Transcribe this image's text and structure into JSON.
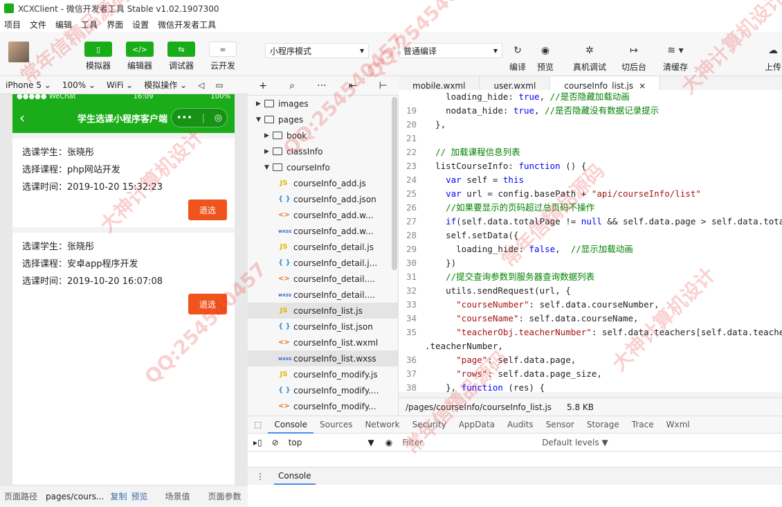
{
  "window": {
    "title": "XCXClient - 微信开发者工具 Stable v1.02.1907300"
  },
  "menu": [
    "项目",
    "文件",
    "编辑",
    "工具",
    "界面",
    "设置",
    "微信开发者工具"
  ],
  "toolbar": {
    "simulator": "模拟器",
    "editor": "编辑器",
    "debugger": "调试器",
    "cloud": "云开发",
    "mode": "小程序模式",
    "compile_mode": "普通编译",
    "compile": "编译",
    "preview": "预览",
    "remote_debug": "真机调试",
    "background": "切后台",
    "clear_cache": "清缓存",
    "upload": "上传"
  },
  "device_bar": {
    "device": "iPhone 5",
    "zoom": "100%",
    "network": "WiFi",
    "ops": "模拟操作"
  },
  "phone": {
    "status_left": "●●●●● WeChat",
    "status_time": "16:09",
    "status_right": "100%",
    "nav_title": "学生选课小程序客户端",
    "records": [
      {
        "student": "选课学生：张晓彤",
        "course": "选择课程：php网站开发",
        "time": "选课时间：2019-10-20 15:32:23",
        "btn": "退选"
      },
      {
        "student": "选课学生：张晓彤",
        "course": "选择课程：安卓app程序开发",
        "time": "选课时间：2019-10-20 16:07:08",
        "btn": "退选"
      }
    ]
  },
  "tree": [
    {
      "name": "images",
      "type": "folder",
      "level": 0,
      "open": false
    },
    {
      "name": "pages",
      "type": "folder",
      "level": 0,
      "open": true
    },
    {
      "name": "book",
      "type": "folder",
      "level": 1,
      "open": false
    },
    {
      "name": "classInfo",
      "type": "folder",
      "level": 1,
      "open": false
    },
    {
      "name": "courseInfo",
      "type": "folder",
      "level": 1,
      "open": true
    },
    {
      "name": "courseInfo_add.js",
      "type": "js",
      "level": 2
    },
    {
      "name": "courseInfo_add.json",
      "type": "json",
      "level": 2
    },
    {
      "name": "courseInfo_add.w...",
      "type": "wxml",
      "level": 2
    },
    {
      "name": "courseInfo_add.w...",
      "type": "wxss",
      "level": 2
    },
    {
      "name": "courseInfo_detail.js",
      "type": "js",
      "level": 2
    },
    {
      "name": "courseInfo_detail.j...",
      "type": "json",
      "level": 2
    },
    {
      "name": "courseInfo_detail....",
      "type": "wxml",
      "level": 2
    },
    {
      "name": "courseInfo_detail....",
      "type": "wxss",
      "level": 2
    },
    {
      "name": "courseInfo_list.js",
      "type": "js",
      "level": 2,
      "selected": true
    },
    {
      "name": "courseInfo_list.json",
      "type": "json",
      "level": 2
    },
    {
      "name": "courseInfo_list.wxml",
      "type": "wxml",
      "level": 2
    },
    {
      "name": "courseInfo_list.wxss",
      "type": "wxss",
      "level": 2,
      "selected": true
    },
    {
      "name": "courseInfo_modify.js",
      "type": "js",
      "level": 2
    },
    {
      "name": "courseInfo_modify....",
      "type": "json",
      "level": 2
    },
    {
      "name": "courseInfo_modify...",
      "type": "wxml",
      "level": 2
    }
  ],
  "tabs": [
    "mobile.wxml",
    "user.wxml",
    "courseInfo_list.js"
  ],
  "code": [
    {
      "n": "",
      "t": "    loading_hide: true, //是否隐藏加载动画"
    },
    {
      "n": "19",
      "t": "    nodata_hide: true, //是否隐藏没有数据记录提示"
    },
    {
      "n": "20",
      "t": "  },"
    },
    {
      "n": "21",
      "t": ""
    },
    {
      "n": "22",
      "t": "  // 加载课程信息列表"
    },
    {
      "n": "23",
      "t": "  listCourseInfo: function () {"
    },
    {
      "n": "24",
      "t": "    var self = this"
    },
    {
      "n": "25",
      "t": "    var url = config.basePath + \"api/courseInfo/list\""
    },
    {
      "n": "26",
      "t": "    //如果要显示的页码超过总页码不操作"
    },
    {
      "n": "27",
      "t": "    if(self.data.totalPage != null && self.data.page > self.data.totalPage) return"
    },
    {
      "n": "28",
      "t": "    self.setData({"
    },
    {
      "n": "29",
      "t": "      loading_hide: false,  //显示加载动画"
    },
    {
      "n": "30",
      "t": "    })"
    },
    {
      "n": "31",
      "t": "    //提交查询参数到服务器查询数据列表"
    },
    {
      "n": "32",
      "t": "    utils.sendRequest(url, {"
    },
    {
      "n": "33",
      "t": "      \"courseNumber\": self.data.courseNumber,"
    },
    {
      "n": "34",
      "t": "      \"courseName\": self.data.courseName,"
    },
    {
      "n": "35",
      "t": "      \"teacherObj.teacherNumber\": self.data.teachers[self.data.teacherIndex]"
    },
    {
      "n": "",
      "t": ".teacherNumber,"
    },
    {
      "n": "36",
      "t": "      \"page\": self.data.page,"
    },
    {
      "n": "37",
      "t": "      \"rows\": self.data.page_size,"
    },
    {
      "n": "38",
      "t": "    }, function (res) {"
    }
  ],
  "pathbar": {
    "path": "/pages/courseInfo/courseInfo_list.js",
    "size": "5.8 KB"
  },
  "devtools": {
    "tabs": [
      "Console",
      "Sources",
      "Network",
      "Security",
      "AppData",
      "Audits",
      "Sensor",
      "Storage",
      "Trace",
      "Wxml"
    ],
    "context": "top",
    "filter_placeholder": "Filter",
    "levels": "Default levels ▼",
    "drawer": "Console"
  },
  "bottom": {
    "path_label": "页面路径",
    "path_value": "pages/cours...",
    "copy": "复制",
    "preview": "预览",
    "scene": "场景值",
    "params": "页面参数"
  },
  "watermarks": [
    "常年信精品源码",
    "QQ:254540457",
    "大神计算机设计"
  ]
}
